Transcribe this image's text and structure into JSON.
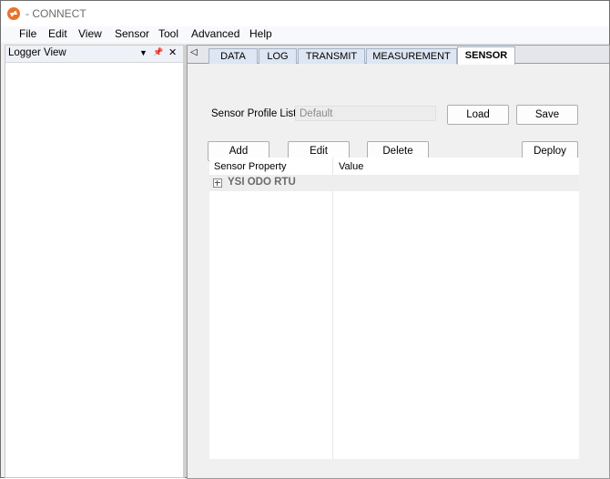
{
  "window": {
    "title": "- CONNECT",
    "accent": "#e8742c"
  },
  "menu": [
    "File",
    "Edit",
    "View",
    "Sensor",
    "Tool",
    "Advanced",
    "Help"
  ],
  "left_pane": {
    "title": "Logger View",
    "dropdown_icon": "▼",
    "pin_icon": "📌",
    "close_icon": "✕"
  },
  "tabs": {
    "scroll_icon": "◁",
    "items": [
      "DATA",
      "LOG",
      "TRANSMIT",
      "MEASUREMENT",
      "SENSOR"
    ],
    "active": "SENSOR"
  },
  "sensor": {
    "profile_label": "Sensor Profile List",
    "profile_value": "Default",
    "buttons": {
      "load": "Load",
      "save": "Save",
      "add": "Add",
      "edit": "Edit",
      "delete": "Delete",
      "deploy": "Deploy"
    },
    "grid": {
      "columns": [
        "Sensor Property",
        "Value"
      ],
      "groups": [
        "YSI ODO RTU"
      ]
    }
  }
}
